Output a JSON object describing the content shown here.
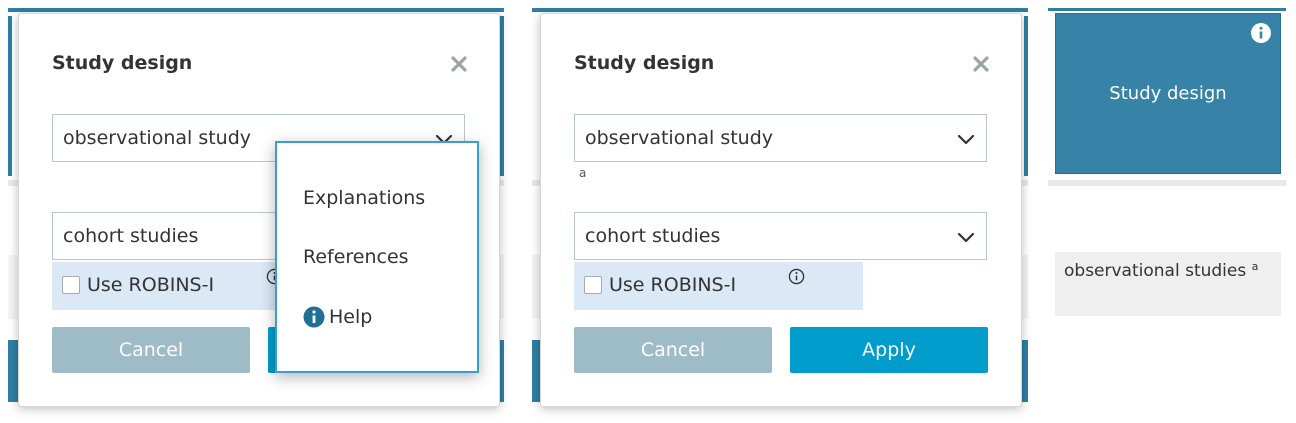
{
  "dialog_left": {
    "title": "Study design",
    "select_design": "observational study",
    "select_subtype": "cohort studies",
    "robins_label": "Use ROBINS-I",
    "robins_checked": false,
    "cancel_label": "Cancel",
    "info_menu": {
      "items": [
        {
          "label": "Explanations"
        },
        {
          "label": "References"
        },
        {
          "label": "Help"
        }
      ]
    }
  },
  "dialog_right": {
    "title": "Study design",
    "select_design": "observational study",
    "footnote_marker": "a",
    "select_subtype": "cohort studies",
    "robins_label": "Use ROBINS-I",
    "robins_checked": false,
    "cancel_label": "Cancel",
    "apply_label": "Apply"
  },
  "tile": {
    "label": "Study design",
    "icon": "info-icon"
  },
  "cell": {
    "text": "observational studies",
    "footnote": "a"
  },
  "colors": {
    "primary": "#009ccc",
    "cancel": "#9ebcc8",
    "tile": "#3782a7",
    "robins_bg": "#dbe8f6"
  }
}
